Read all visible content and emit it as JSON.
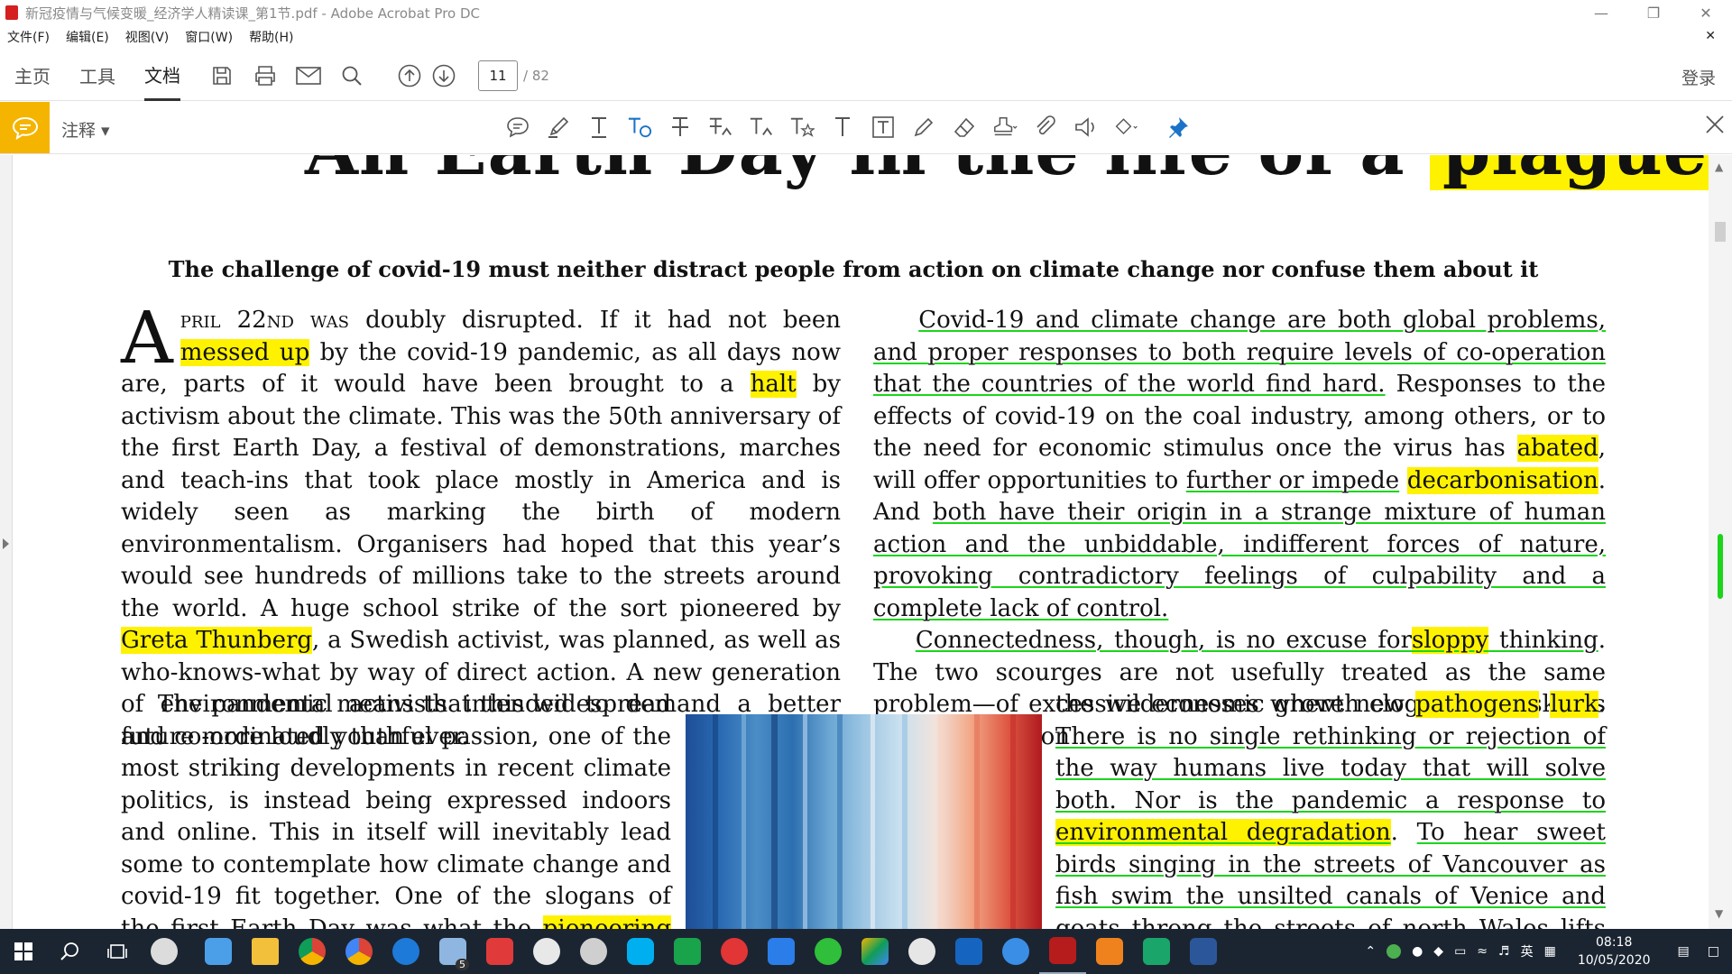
{
  "window": {
    "title": "新冠疫情与气候变暖_经济学人精读课_第1节.pdf - Adobe Acrobat Pro DC"
  },
  "menu": [
    "文件(F)",
    "编辑(E)",
    "视图(V)",
    "窗口(W)",
    "帮助(H)"
  ],
  "toolbar": {
    "tabs": [
      "主页",
      "工具",
      "文档"
    ],
    "active_tab": "文档",
    "page_current": "11",
    "page_total": "/ 82",
    "login": "登录"
  },
  "annotation_bar": {
    "label": "注释",
    "tools": [
      "sticky-note-icon",
      "highlight-pen-icon",
      "underline-text-icon",
      "strikethrough-text-icon",
      "add-text-icon",
      "replace-text-icon",
      "insert-text-icon",
      "text-comment-icon",
      "typewriter-icon",
      "textbox-icon",
      "pencil-icon",
      "eraser-icon",
      "stamp-icon",
      "attach-icon",
      "record-audio-icon",
      "shapes-icon",
      "pin-icon"
    ]
  },
  "document": {
    "title": "An Earth Day in the life of a plague",
    "subtitle": "The challenge of covid-19 must neither distract people from action on climate change nor confuse them about it"
  },
  "colors": {
    "highlight": "#fff200",
    "underline": "#1cd41c",
    "annotation_accent": "#f5b400",
    "taskbar": "#1b2532"
  },
  "taskbar": {
    "time": "08:18",
    "date": "10/05/2020",
    "lang": "英",
    "mail_badge": "5"
  }
}
